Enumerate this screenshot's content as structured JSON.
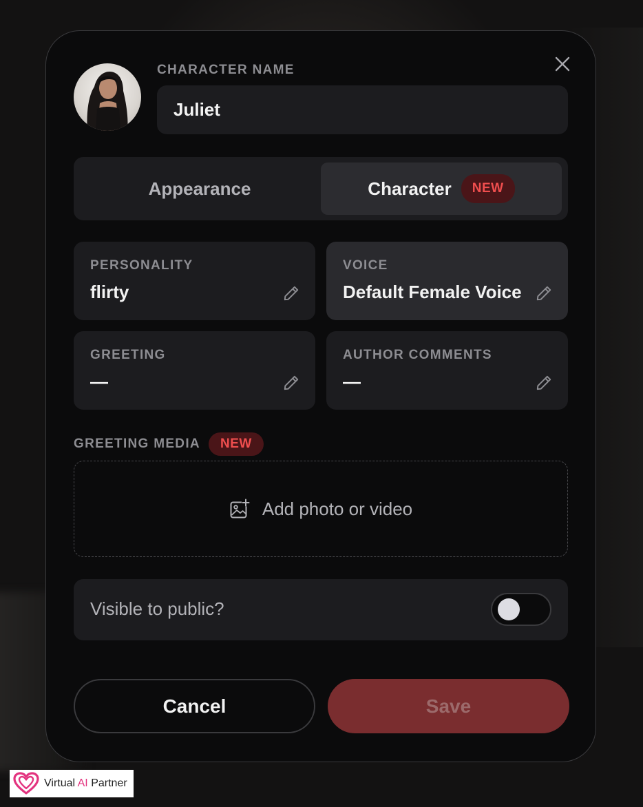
{
  "modal": {
    "name_label": "CHARACTER NAME",
    "name_value": "Juliet",
    "tabs": [
      {
        "label": "Appearance",
        "selected": false
      },
      {
        "label": "Character",
        "selected": true,
        "badge": "NEW"
      }
    ],
    "fields": {
      "personality": {
        "label": "PERSONALITY",
        "value": "flirty"
      },
      "voice": {
        "label": "VOICE",
        "value": "Default Female Voice"
      },
      "greeting": {
        "label": "GREETING",
        "value": "—"
      },
      "author_comments": {
        "label": "AUTHOR COMMENTS",
        "value": "—"
      }
    },
    "greeting_media": {
      "label": "GREETING MEDIA",
      "badge": "NEW",
      "add_label": "Add photo or video"
    },
    "visibility": {
      "label": "Visible to public?",
      "enabled": false
    },
    "buttons": {
      "cancel": "Cancel",
      "save": "Save"
    }
  },
  "watermark": {
    "prefix": "Virtual ",
    "ai": "AI",
    "suffix": " Partner"
  },
  "icons": {
    "close": "close-icon",
    "edit": "pencil-icon",
    "media": "image-plus-icon",
    "logo": "heart-logo-icon"
  },
  "colors": {
    "accent_save": "#7a2d2f",
    "badge_bg": "#4a1518",
    "badge_text": "#ef4e4e",
    "panel": "#1c1c1f",
    "modal_bg": "#0b0b0c"
  }
}
